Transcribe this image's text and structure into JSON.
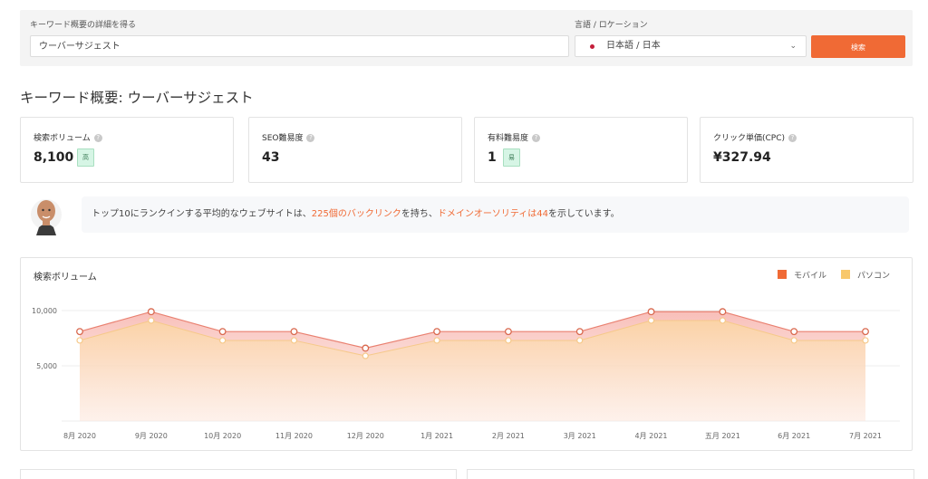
{
  "search": {
    "keyword_label": "キーワード概要の詳細を得る",
    "keyword_value": "ウーバーサジェスト",
    "language_label": "言語 / ロケーション",
    "language_value": "日本語 / 日本",
    "search_button": "検索"
  },
  "overview": {
    "title": "キーワード概要: ウーバーサジェスト"
  },
  "cards": [
    {
      "label": "検索ボリューム",
      "value": "8,100",
      "badge": "高"
    },
    {
      "label": "SEO難易度",
      "value": "43"
    },
    {
      "label": "有料難易度",
      "value": "1",
      "badge": "易"
    },
    {
      "label": "クリック単価(CPC)",
      "value": "¥327.94"
    }
  ],
  "tip": {
    "prefix": "トップ10にランクインする平均的なウェブサイトは、",
    "backlinks": "225個のバックリンク",
    "middle": "を持ち、",
    "authority": "ドメインオーソリティは44",
    "suffix": "を示しています。"
  },
  "icons": {
    "help": "help-icon",
    "avatar": "avatar-icon",
    "flag": "japan-flag-icon",
    "chevron": "chevron-down-icon"
  },
  "colors": {
    "accent": "#f06a35",
    "mobile": "#f06a35",
    "desktop": "#f8c86c",
    "badge_bg": "#d6f5e5"
  },
  "chart_data": {
    "type": "area",
    "title": "検索ボリューム",
    "categories": [
      "8月 2020",
      "9月 2020",
      "10月 2020",
      "11月 2020",
      "12月 2020",
      "1月 2021",
      "2月 2021",
      "3月 2021",
      "4月 2021",
      "五月 2021",
      "6月 2021",
      "7月 2021"
    ],
    "y_ticks": [
      "10,000",
      "5,000"
    ],
    "ylim": [
      0,
      10000
    ],
    "series": [
      {
        "name": "モバイル",
        "values": [
          8100,
          9900,
          8100,
          8100,
          6600,
          8100,
          8100,
          8100,
          9900,
          9900,
          8100,
          8100
        ]
      },
      {
        "name": "パソコン",
        "values": [
          7300,
          9100,
          7300,
          7300,
          5900,
          7300,
          7300,
          7300,
          9100,
          9100,
          7300,
          7300
        ]
      }
    ],
    "grid": true,
    "legend_position": "top-right"
  }
}
